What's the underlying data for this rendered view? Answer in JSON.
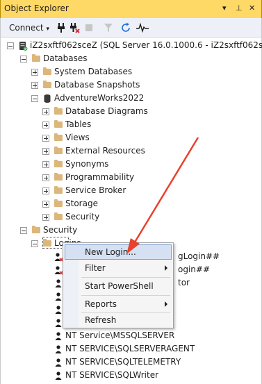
{
  "window": {
    "title": "Object Explorer",
    "controls": [
      "▾",
      "⊥",
      "✕"
    ]
  },
  "toolbar": {
    "connect_label": "Connect",
    "connect_caret": "▾"
  },
  "tree": {
    "server": "iZ2sxftf062sceZ (SQL Server 16.0.1000.6 - iZ2sxftf062sc",
    "databases": "Databases",
    "system_databases": "System Databases",
    "database_snapshots": "Database Snapshots",
    "adventureworks": "AdventureWorks2022",
    "database_diagrams": "Database Diagrams",
    "tables": "Tables",
    "views": "Views",
    "external_resources": "External Resources",
    "synonyms": "Synonyms",
    "programmability": "Programmability",
    "service_broker": "Service Broker",
    "storage": "Storage",
    "db_security": "Security",
    "security": "Security",
    "logins": "Logins",
    "login_1_tail": "gLogin##",
    "login_2_tail": "ogin##",
    "login_3_tail": "tor",
    "login_mssqlserver": "NT Service\\MSSQLSERVER",
    "login_sqlserveragent": "NT SERVICE\\SQLSERVERAGENT",
    "login_sqltelemetry": "NT SERVICE\\SQLTELEMETRY",
    "login_sqlwriter": "NT SERVICE\\SQLWriter"
  },
  "context_menu": {
    "new_login": "New Login...",
    "filter": "Filter",
    "start_powershell": "Start PowerShell",
    "reports": "Reports",
    "refresh": "Refresh"
  },
  "colors": {
    "title_bg": "#ffd966",
    "menu_highlight": "#d5e1f2",
    "annotation_arrow": "#e8412c"
  }
}
